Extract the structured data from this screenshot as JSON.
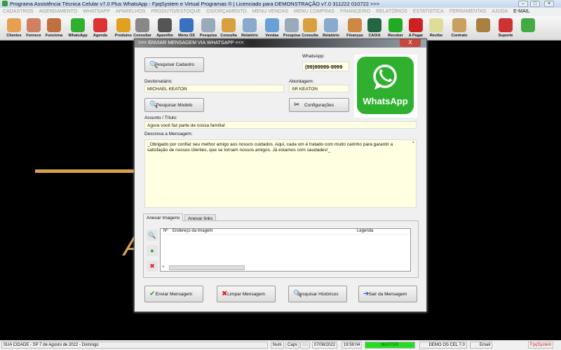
{
  "window": {
    "title": "Programa Assistência Técnica Celular v7.0 Plus WhatsApp - FpqSystem e Virtual Programas ® | Licenciado para  DEMONSTRAÇÃO v7.0 311222 010722 >>>"
  },
  "menu": [
    "CADASTROS",
    "AGENDAMENTO",
    "WHATSAPP",
    "APARELHOS",
    "PRODUTO/ESTOQUE",
    "OS/ORÇAMENTO",
    "MENU VENDAS",
    "MENU COMPRAS",
    "FINANCEIRO",
    "RELATÓRIOS",
    "ESTATISTICA",
    "FERRAMENTAS",
    "AJUDA",
    "E-MAIL"
  ],
  "toolbar": [
    {
      "label": "Clientes",
      "icon": "clients-icon",
      "color": "#e8a050"
    },
    {
      "label": "Fornece",
      "icon": "supplier-icon",
      "color": "#d08060"
    },
    {
      "label": "Funciona",
      "icon": "employee-icon",
      "color": "#c07040"
    },
    {
      "label": "WhatsApp",
      "icon": "whatsapp-icon",
      "color": "#2fb12f"
    },
    {
      "label": "Agenda",
      "icon": "calendar-icon",
      "color": "#d33"
    },
    {
      "label": "Produtos",
      "icon": "products-icon",
      "color": "#e0a020"
    },
    {
      "label": "Consultar",
      "icon": "barcode-icon",
      "color": "#888"
    },
    {
      "label": "Aparelho",
      "icon": "device-icon",
      "color": "#555"
    },
    {
      "label": "Menu OS",
      "icon": "service-order-icon",
      "color": "#3a70c0"
    },
    {
      "label": "Pesquisa",
      "icon": "search-icon",
      "color": "#9ab"
    },
    {
      "label": "Consulta",
      "icon": "folder-icon",
      "color": "#d8a040"
    },
    {
      "label": "Relatório",
      "icon": "report-icon",
      "color": "#8ac"
    },
    {
      "label": "Vendas",
      "icon": "monitor-icon",
      "color": "#6aa0d8"
    },
    {
      "label": "Pesquisa",
      "icon": "search-icon",
      "color": "#9ab"
    },
    {
      "label": "Consulta",
      "icon": "folder-icon",
      "color": "#d8a040"
    },
    {
      "label": "Relatório",
      "icon": "report-icon",
      "color": "#8ac"
    },
    {
      "label": "Finanças",
      "icon": "finance-icon",
      "color": "#c84"
    },
    {
      "label": "CAIXA",
      "icon": "cash-icon",
      "color": "#264"
    },
    {
      "label": "Receber",
      "icon": "receive-icon",
      "color": "#2a2"
    },
    {
      "label": "A Pagar",
      "icon": "pay-icon",
      "color": "#c22"
    },
    {
      "label": "Recibo",
      "icon": "receipt-icon",
      "color": "#dd9"
    },
    {
      "label": "Contrato",
      "icon": "contract-icon",
      "color": "#c9a060"
    },
    {
      "label": "",
      "icon": "coins-icon",
      "color": "#a88040"
    },
    {
      "label": "Suporte",
      "icon": "support-icon",
      "color": "#c33"
    },
    {
      "label": "",
      "icon": "exit-icon",
      "color": "#4a4"
    }
  ],
  "dialog": {
    "title": ">>> ENVIAR MENSAGEM VIA WHATSAPP <<<",
    "close": "X",
    "search_contact": "Pesquisar Cadastro",
    "whatsapp_label": "WhatsApp:",
    "whatsapp_value": "(99)99999-9999",
    "logo_text": "WhatsApp",
    "recipient_label": "Destionatário:",
    "recipient_value": "MICHAEL KEATON",
    "greeting_label": "Abordagem:",
    "greeting_value": "SR KEATON",
    "search_template": "Pesquisar Modelo",
    "settings": "Configurações",
    "subject_label": "Assunto / Título:",
    "subject_value": "Agora você faz parte de nossa família!",
    "message_label": "Descreva a Mensagem:",
    "message_value": "_Obrigado por confiar seu melhor amigo aos nossos cuidados. Aqui, cada um é tratado com muito carinho para garantir a satisfação de nossos clientes, que se tornam nossos amigos. Já estamos com saudades!_",
    "tabs": [
      "Anexar Imagens",
      "Anexar links"
    ],
    "grid_headers": [
      "Nº",
      "Endereço da Imagem",
      "Legenda"
    ],
    "buttons": {
      "send": "Enviar Mensagem",
      "clear": "Limpar Mensagem",
      "history": "Pesquisar Históricos",
      "exit": "Sair da Mensagem"
    }
  },
  "status": {
    "city": "SUA CIDADE - SP  7 de Agosto de 2022 - Domingo",
    "num": "Num",
    "caps": "Caps",
    "ins": "Ins",
    "date": "07/08/2022",
    "time": "19:59:04",
    "user": "MASTER",
    "user_color": "#22dd22",
    "db": "DEMO OS CEL 7.0",
    "email": "Email",
    "brand": "FpqSystem"
  }
}
